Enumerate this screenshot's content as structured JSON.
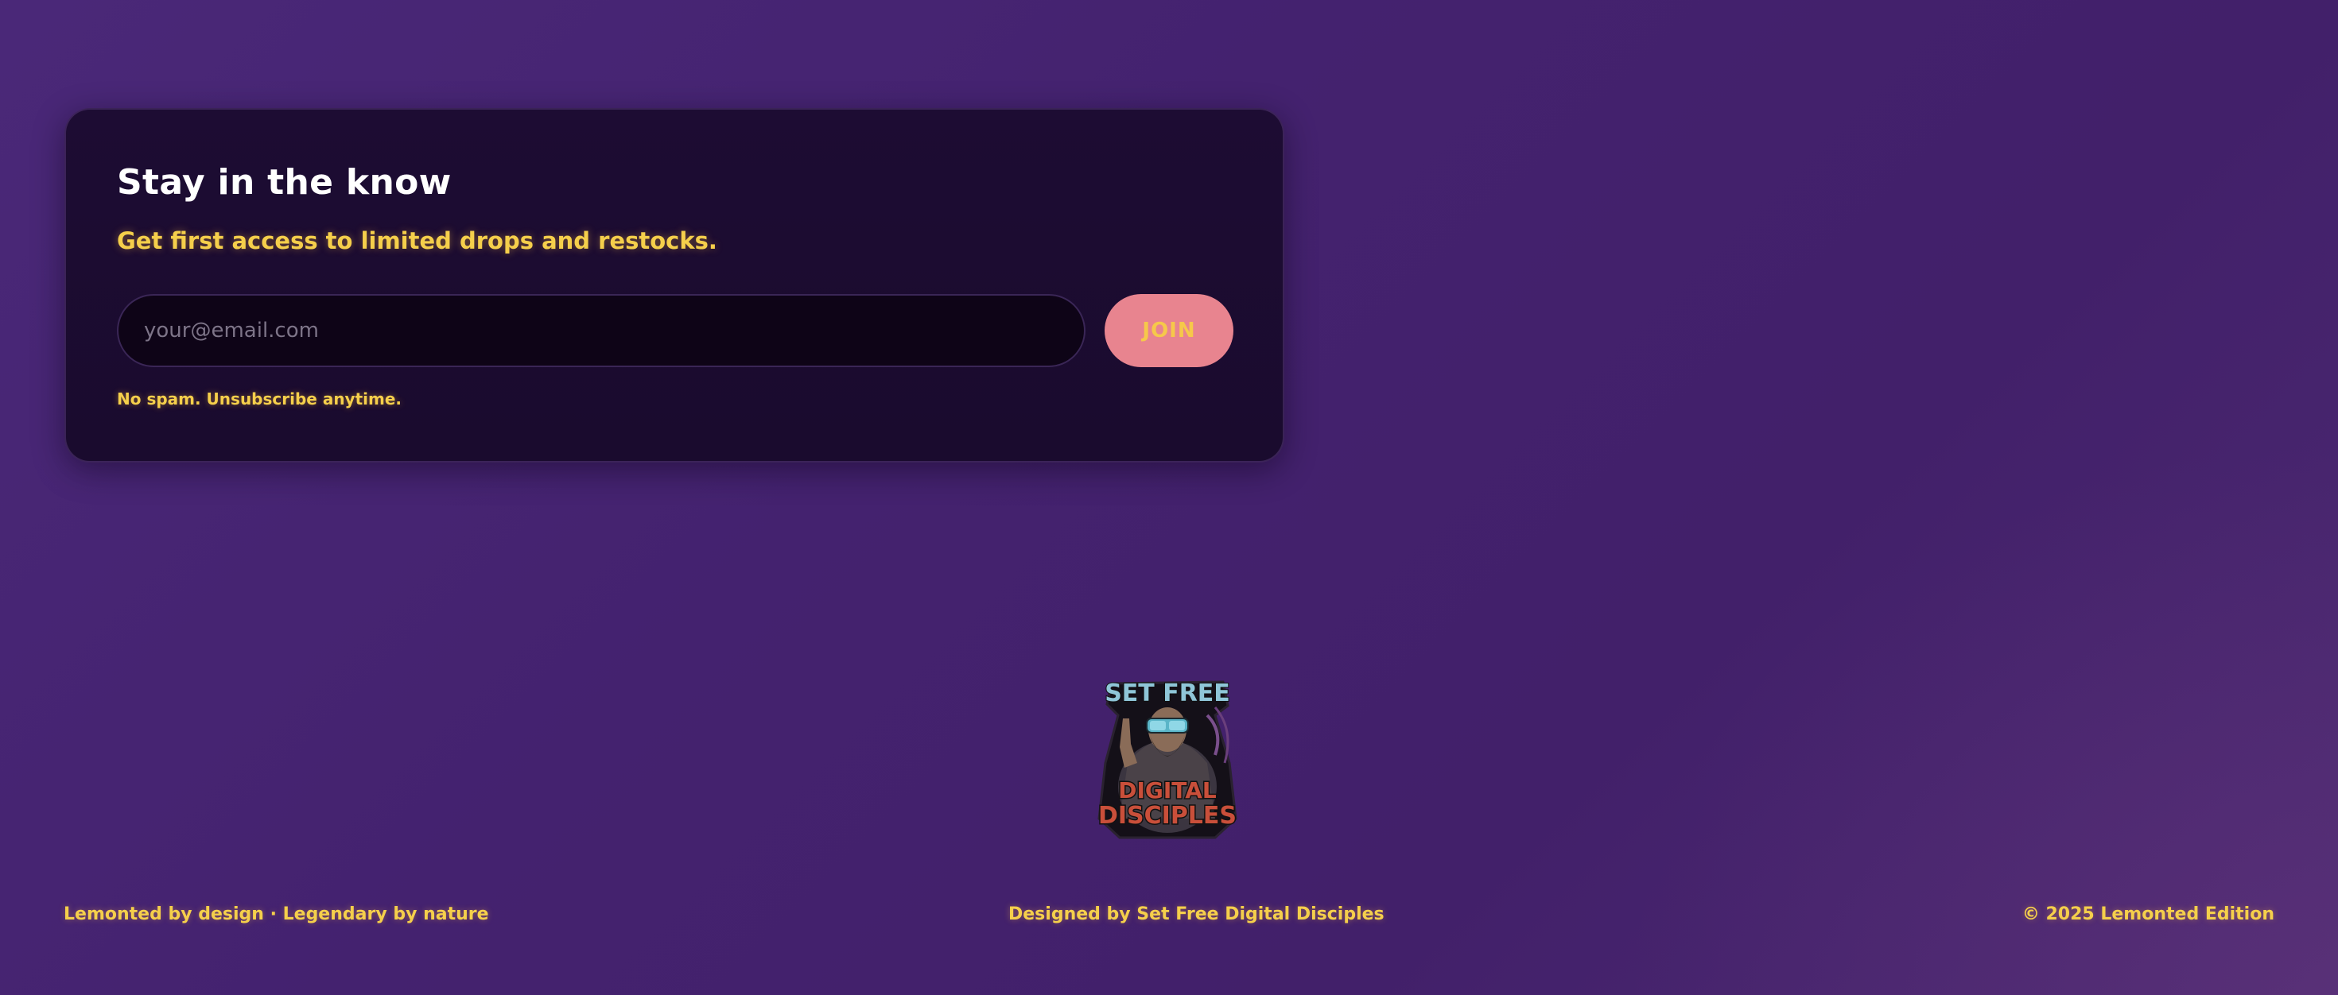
{
  "newsletter": {
    "title": "Stay in the know",
    "subtitle": "Get first access to limited drops and restocks.",
    "email_placeholder": "your@email.com",
    "join_label": "JOIN",
    "note": "No spam. Unsubscribe anytime."
  },
  "logo": {
    "icon": "set-free-digital-disciples-logo",
    "top_text": "SET FREE",
    "bottom_text_1": "DIGITAL",
    "bottom_text_2": "DISCIPLES"
  },
  "footer": {
    "left": "Lemonted by design · Legendary by nature",
    "center": "Designed by Set Free Digital Disciples",
    "right": "© 2025 Lemonted Edition"
  },
  "colors": {
    "background": "#44226f",
    "card": "#1d0c33",
    "accent_yellow": "#f5cf4b",
    "button_pink": "#e8848f"
  }
}
